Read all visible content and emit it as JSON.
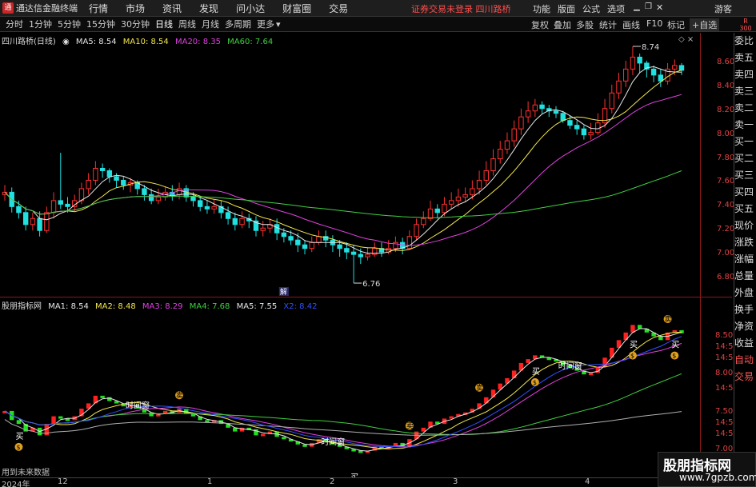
{
  "topbar": {
    "app_title": "通达信金融终端",
    "menus": [
      "行情",
      "市场",
      "资讯",
      "发现",
      "问小达",
      "财富圈",
      "交易"
    ],
    "notice": "证券交易未登录  四川路桥",
    "right_items": [
      "功能",
      "版面",
      "公式",
      "选项"
    ],
    "guest": "游客",
    "window_controls": [
      "minimize-icon",
      "restore-icon",
      "close-icon"
    ]
  },
  "toolbar": {
    "periods": [
      "分时",
      "1分钟",
      "5分钟",
      "15分钟",
      "30分钟",
      "日线",
      "周线",
      "月线",
      "多周期",
      "更多"
    ],
    "active_period": "日线",
    "right_tools": [
      "复权",
      "叠加",
      "多股",
      "统计",
      "画线",
      "F10",
      "标记",
      "+自选"
    ]
  },
  "r_badge": {
    "letter": "R",
    "number": "300"
  },
  "panel1": {
    "stock": "四川路桥(日线)",
    "ma": [
      {
        "label": "MA5: 8.54",
        "color": "#e6e6e6"
      },
      {
        "label": "MA10: 8.54",
        "color": "#f2e64a"
      },
      {
        "label": "MA20: 8.35",
        "color": "#e040e0"
      },
      {
        "label": "MA60: 7.64",
        "color": "#40d040"
      }
    ],
    "axis_ticks": [
      "8.60",
      "8.40",
      "8.20",
      "8.00",
      "7.80",
      "7.60",
      "7.40",
      "7.20",
      "7.00",
      "6.80"
    ],
    "high_label": "8.74",
    "low_label": "6.76",
    "jie_label": "解"
  },
  "panel2": {
    "name": "股朋指标网",
    "ma": [
      {
        "label": "MA1: 8.54",
        "color": "#e6e6e6"
      },
      {
        "label": "MA2: 8.48",
        "color": "#f2e64a"
      },
      {
        "label": "MA3: 8.29",
        "color": "#e040e0"
      },
      {
        "label": "MA4: 7.68",
        "color": "#40d040"
      },
      {
        "label": "MA5: 7.55",
        "color": "#e6e6e6"
      },
      {
        "label": "X2: 8.42",
        "color": "#3050ff"
      }
    ],
    "axis_ticks": [
      "8.50",
      "14:56",
      "14:56",
      "8.00",
      "14:56",
      "7.50",
      "14:56",
      "14:56",
      "7.00",
      "14:56"
    ],
    "signals": {
      "buy": "买",
      "sell": "卖",
      "window": "时间窗",
      "coin": "$"
    }
  },
  "sidepanel": {
    "items": [
      "委比",
      "卖五",
      "卖四",
      "卖三",
      "卖二",
      "卖一",
      "买一",
      "买二",
      "买三",
      "买四",
      "买五",
      "现价",
      "涨跌",
      "涨幅",
      "总量",
      "外盘",
      "换手",
      "净资",
      "收益",
      "自动",
      "交易"
    ]
  },
  "bottom": {
    "no_data": "用到未来数据",
    "dates": [
      "2024年",
      "12",
      "1",
      "2",
      "3",
      "4"
    ]
  },
  "watermark": {
    "line1": "股朋指标网",
    "line2": "www.7gpzb.com"
  },
  "chart_data": [
    {
      "type": "candlestick",
      "ylim": [
        6.7,
        8.8
      ],
      "open": [
        7.5,
        7.52,
        7.4,
        7.35,
        7.25,
        7.3,
        7.2,
        7.35,
        7.45,
        7.42,
        7.4,
        7.45,
        7.55,
        7.62,
        7.72,
        7.7,
        7.65,
        7.62,
        7.58,
        7.6,
        7.55,
        7.5,
        7.45,
        7.48,
        7.52,
        7.5,
        7.55,
        7.48,
        7.45,
        7.4,
        7.38,
        7.4,
        7.35,
        7.3,
        7.25,
        7.3,
        7.28,
        7.2,
        7.22,
        7.25,
        7.18,
        7.15,
        7.12,
        7.08,
        7.05,
        7.1,
        7.15,
        7.12,
        7.08,
        7.05,
        7.02,
        7.0,
        6.98,
        7.0,
        7.05,
        7.02,
        7.05,
        7.1,
        7.05,
        7.15,
        7.25,
        7.3,
        7.38,
        7.35,
        7.42,
        7.45,
        7.48,
        7.5,
        7.55,
        7.62,
        7.7,
        7.8,
        7.88,
        7.95,
        8.05,
        8.15,
        8.2,
        8.25,
        8.22,
        8.2,
        8.18,
        8.12,
        8.08,
        8.05,
        8.0,
        8.02,
        8.1,
        8.22,
        8.35,
        8.45,
        8.55,
        8.65,
        8.6,
        8.55,
        8.5,
        8.45,
        8.55,
        8.58
      ],
      "close": [
        7.52,
        7.4,
        7.35,
        7.25,
        7.3,
        7.2,
        7.35,
        7.45,
        7.42,
        7.4,
        7.45,
        7.55,
        7.62,
        7.72,
        7.7,
        7.65,
        7.62,
        7.58,
        7.6,
        7.55,
        7.5,
        7.45,
        7.48,
        7.52,
        7.5,
        7.55,
        7.48,
        7.45,
        7.4,
        7.38,
        7.4,
        7.35,
        7.3,
        7.25,
        7.3,
        7.28,
        7.2,
        7.22,
        7.25,
        7.18,
        7.15,
        7.12,
        7.08,
        7.05,
        7.1,
        7.15,
        7.12,
        7.08,
        7.05,
        7.02,
        7.0,
        6.98,
        7.0,
        7.05,
        7.02,
        7.05,
        7.1,
        7.05,
        7.15,
        7.25,
        7.3,
        7.38,
        7.35,
        7.42,
        7.45,
        7.48,
        7.5,
        7.55,
        7.62,
        7.7,
        7.8,
        7.88,
        7.95,
        8.05,
        8.15,
        8.2,
        8.25,
        8.22,
        8.2,
        8.18,
        8.12,
        8.08,
        8.05,
        8.0,
        8.02,
        8.1,
        8.22,
        8.35,
        8.45,
        8.55,
        8.65,
        8.6,
        8.55,
        8.5,
        8.45,
        8.55,
        8.58,
        8.54
      ],
      "high": [
        7.58,
        7.56,
        7.45,
        7.4,
        7.35,
        7.36,
        7.4,
        7.52,
        7.85,
        7.48,
        7.5,
        7.6,
        7.68,
        7.78,
        7.76,
        7.72,
        7.68,
        7.65,
        7.64,
        7.62,
        7.58,
        7.55,
        7.55,
        7.57,
        7.58,
        7.6,
        7.58,
        7.52,
        7.48,
        7.45,
        7.46,
        7.45,
        7.4,
        7.35,
        7.36,
        7.34,
        7.32,
        7.28,
        7.3,
        7.3,
        7.22,
        7.2,
        7.18,
        7.12,
        7.15,
        7.2,
        7.2,
        7.16,
        7.12,
        7.1,
        7.08,
        7.05,
        7.06,
        7.1,
        7.1,
        7.12,
        7.15,
        7.14,
        7.2,
        7.3,
        7.36,
        7.45,
        7.42,
        7.48,
        7.52,
        7.55,
        7.56,
        7.62,
        7.7,
        7.78,
        7.88,
        7.95,
        8.02,
        8.12,
        8.22,
        8.28,
        8.3,
        8.28,
        8.25,
        8.24,
        8.2,
        8.16,
        8.12,
        8.08,
        8.1,
        8.18,
        8.3,
        8.42,
        8.52,
        8.62,
        8.74,
        8.68,
        8.62,
        8.58,
        8.55,
        8.6,
        8.63,
        8.6
      ],
      "low": [
        7.45,
        7.35,
        7.3,
        7.2,
        7.2,
        7.15,
        7.18,
        7.3,
        7.38,
        7.35,
        7.36,
        7.42,
        7.5,
        7.58,
        7.64,
        7.6,
        7.56,
        7.54,
        7.52,
        7.5,
        7.45,
        7.42,
        7.42,
        7.45,
        7.45,
        7.46,
        7.44,
        7.4,
        7.36,
        7.34,
        7.34,
        7.3,
        7.25,
        7.2,
        7.22,
        7.22,
        7.15,
        7.15,
        7.18,
        7.12,
        7.1,
        7.08,
        7.02,
        7.0,
        7.02,
        7.08,
        7.06,
        7.02,
        6.98,
        6.96,
        6.76,
        6.92,
        6.95,
        6.98,
        6.98,
        7.0,
        7.02,
        7.0,
        7.04,
        7.12,
        7.22,
        7.28,
        7.3,
        7.32,
        7.38,
        7.4,
        7.44,
        7.46,
        7.5,
        7.58,
        7.66,
        7.76,
        7.84,
        7.9,
        8.0,
        8.1,
        8.15,
        8.18,
        8.15,
        8.14,
        8.1,
        8.05,
        8.0,
        7.96,
        7.96,
        8.0,
        8.06,
        8.18,
        8.3,
        8.4,
        8.5,
        8.52,
        8.48,
        8.44,
        8.4,
        8.42,
        8.5,
        8.5
      ],
      "ma_lines": [
        {
          "name": "MA5",
          "color": "#e6e6e6"
        },
        {
          "name": "MA10",
          "color": "#f2e64a"
        },
        {
          "name": "MA20",
          "color": "#e040e0"
        },
        {
          "name": "MA60",
          "color": "#40d040"
        }
      ]
    },
    {
      "type": "bar",
      "ylim": [
        6.7,
        8.8
      ],
      "note_colors": {
        "up": "#ff2020",
        "down": "#20e020"
      },
      "lines": [
        {
          "name": "MA1",
          "color": "#e6e6e6"
        },
        {
          "name": "MA2",
          "color": "#f2e64a"
        },
        {
          "name": "MA3",
          "color": "#e040e0"
        },
        {
          "name": "MA4",
          "color": "#40d040"
        },
        {
          "name": "MA5",
          "color": "#b0b0b0"
        },
        {
          "name": "X2",
          "color": "#3050ff"
        }
      ],
      "buy_points": [
        2,
        50,
        76,
        90,
        96
      ],
      "sell_points": [
        25,
        58,
        68,
        95
      ],
      "window_points": [
        18,
        46,
        80
      ]
    }
  ]
}
